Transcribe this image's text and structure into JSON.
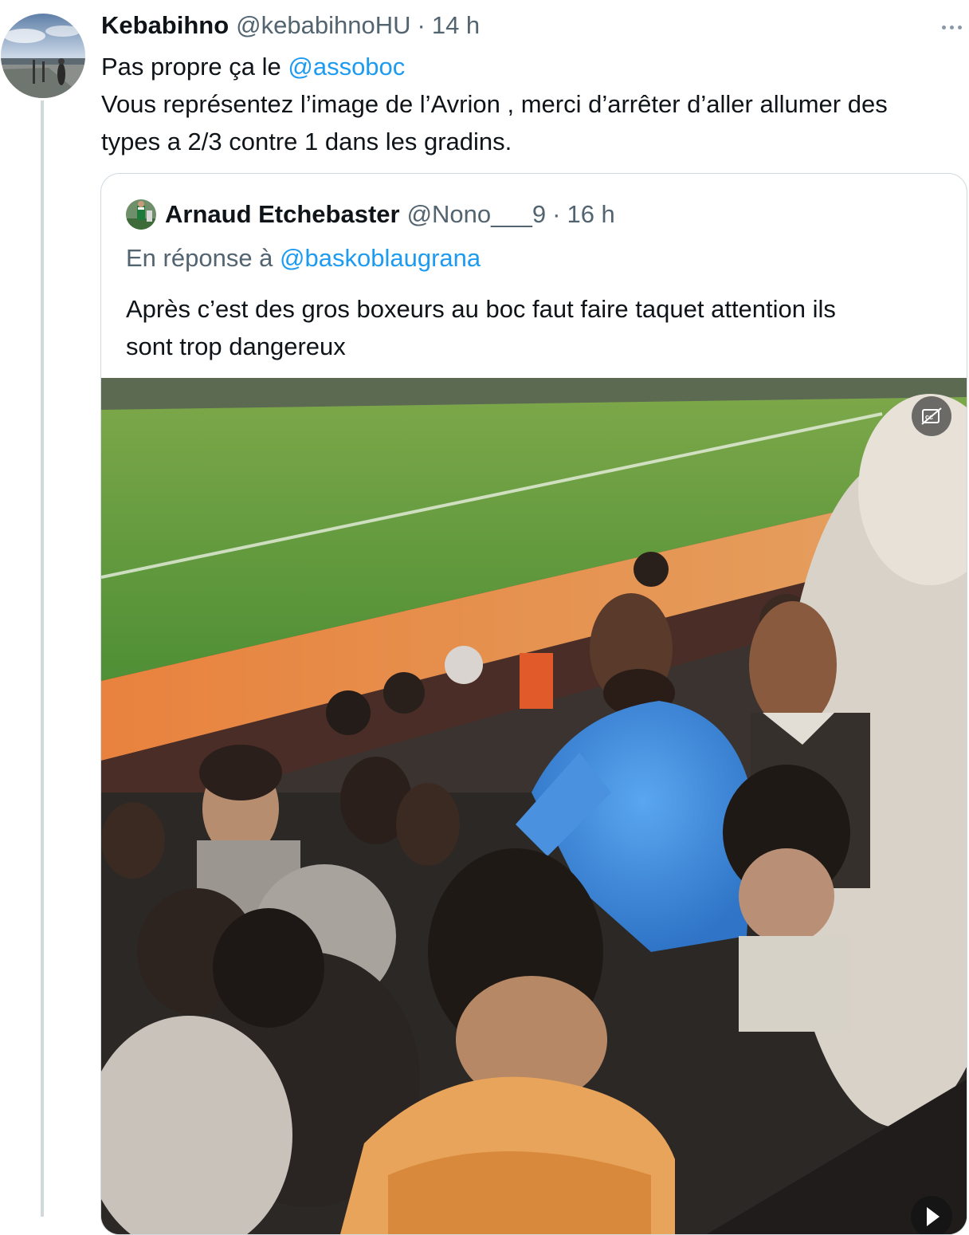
{
  "tweet": {
    "author_name": "Kebabihno",
    "author_handle": "@kebabihnoHU",
    "separator": "·",
    "time": "14 h",
    "line1_prefix": "Pas propre ça le ",
    "line1_mention": "@assoboc",
    "line2": "Vous représentez l’image de l’Avrion , merci d’arrêter d’aller allumer des",
    "line3": "types a 2/3 contre 1 dans les gradins.",
    "more_icon": "more-horizontal-icon"
  },
  "quoted": {
    "author_name": "Arnaud Etchebaster",
    "author_handle": "@Nono___9",
    "separator": "·",
    "time": "16 h",
    "reply_prefix": "En réponse à ",
    "reply_mention": "@baskoblaugrana",
    "line1": "Après c’est des gros boxeurs au boc faut faire taquet attention ils",
    "line2": "sont trop dangereux",
    "media_type": "video",
    "captions_icon": "captions-off-icon",
    "play_icon": "play-icon"
  },
  "colors": {
    "text": "#0f1419",
    "secondary": "#536471",
    "link": "#1d9bf0",
    "border": "#cfd9de"
  }
}
